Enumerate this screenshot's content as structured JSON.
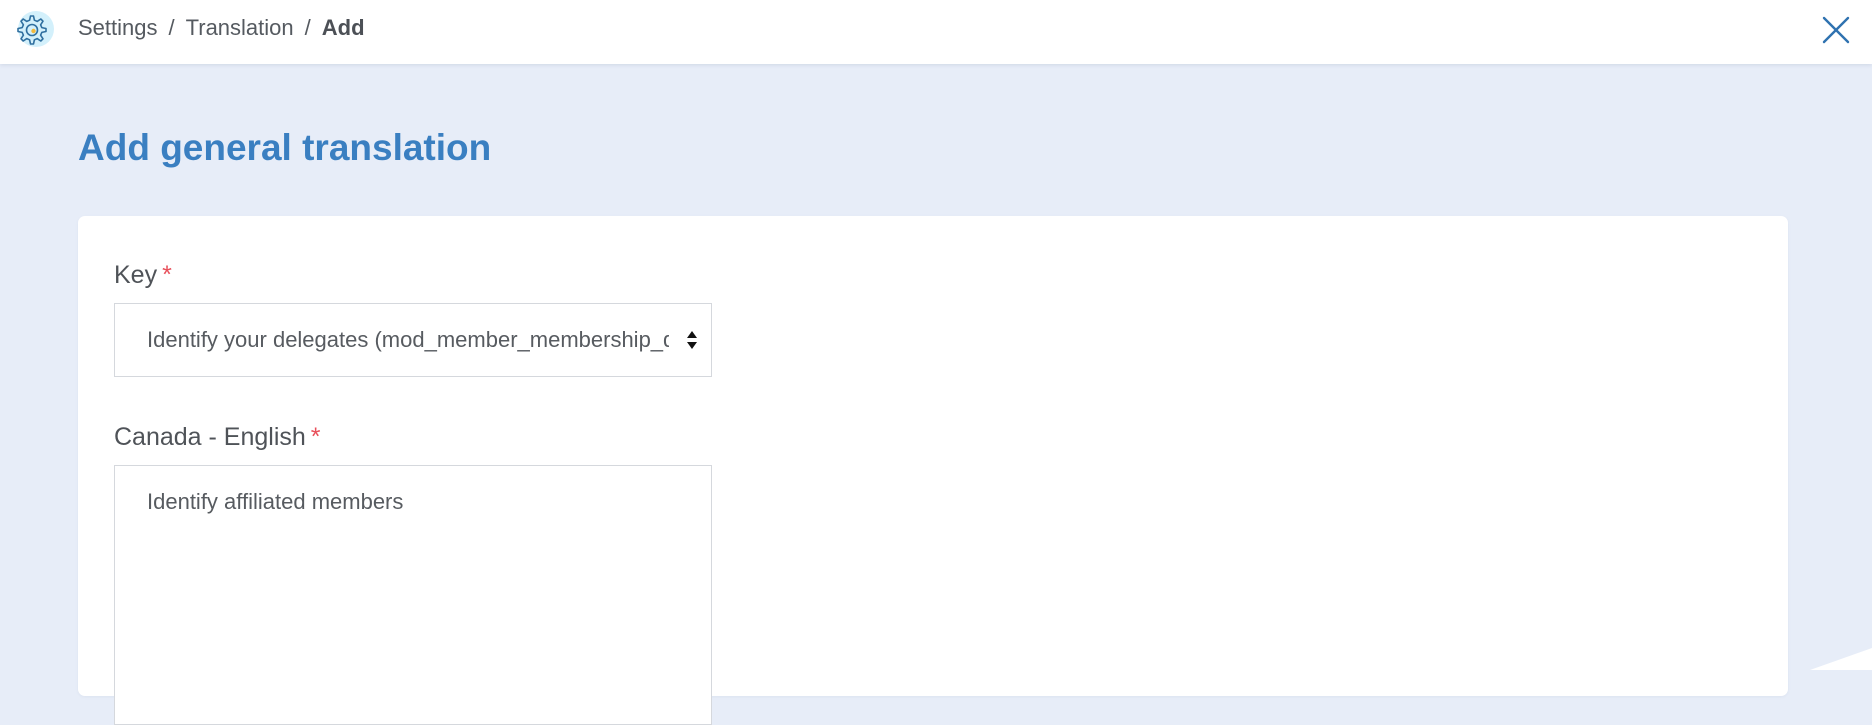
{
  "header": {
    "breadcrumb": [
      {
        "label": "Settings"
      },
      {
        "label": "Translation"
      },
      {
        "label": "Add"
      }
    ],
    "separator": "/",
    "app_icon": "gear-icon",
    "close_icon": "close-icon"
  },
  "page": {
    "title": "Add general translation"
  },
  "form": {
    "key": {
      "label": "Key",
      "required_mark": "*",
      "value": "Identify your delegates (mod_member_membership_delegates)"
    },
    "canada_english": {
      "label": "Canada - English",
      "required_mark": "*",
      "value": "Identify affiliated members"
    }
  },
  "colors": {
    "accent": "#3a7fc1",
    "background": "#e7edf8",
    "required": "#e8505b",
    "icon_bg": "#d3f0fb"
  }
}
